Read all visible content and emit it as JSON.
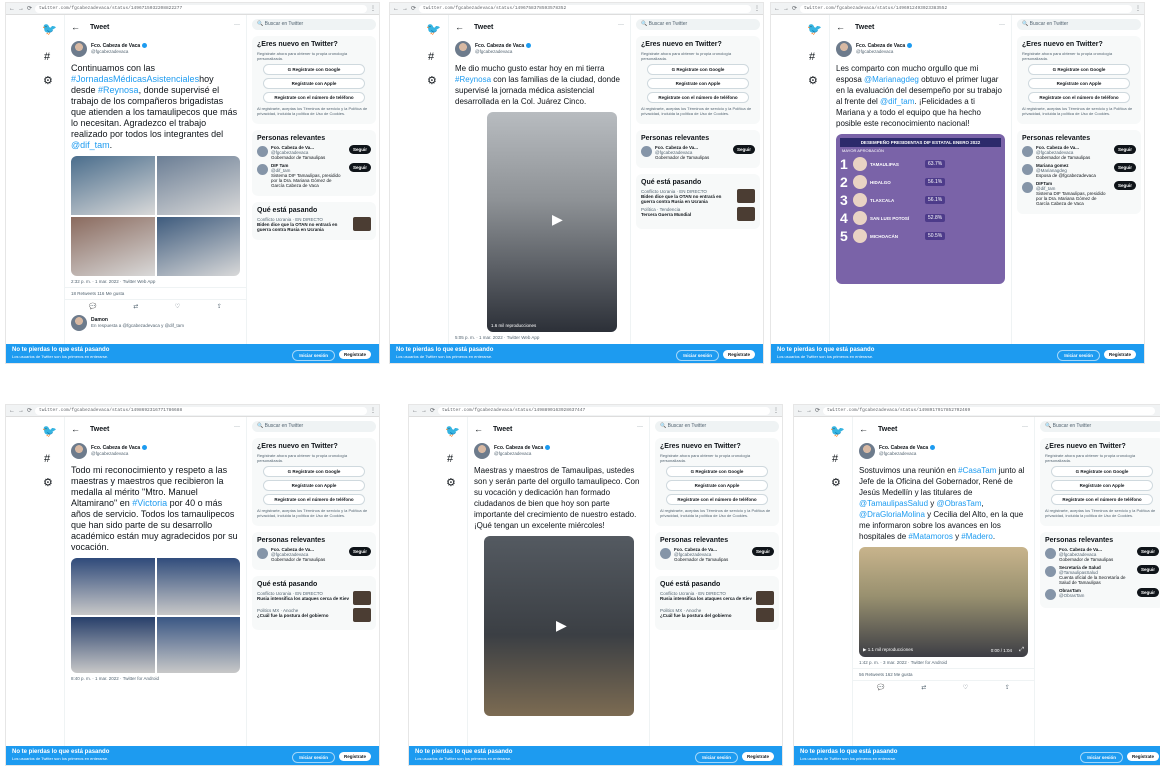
{
  "common": {
    "tweet_header": "Tweet",
    "search_placeholder": "Buscar en Twitter",
    "signup_title": "¿Eres nuevo en Twitter?",
    "signup_subtitle": "Regístrate ahora para obtener tu propia cronología personalizada.",
    "google_button": "Regístrate con Google",
    "apple_button": "Regístrate con Apple",
    "phone_button": "Regístrate con el número de teléfono",
    "terms_text": "Al registrarte, aceptas los Términos de servicio y la Política de privacidad, incluida la política de Uso de Cookies.",
    "relevant_people_title": "Personas relevantes",
    "whats_happening_title": "Qué está pasando",
    "follow_label": "Seguir",
    "banner_title": "No te pierdas lo que está pasando",
    "banner_subtitle": "Los usuarios de Twitter son los primeros en enterarse.",
    "login_label": "Iniciar sesión",
    "signup_label": "Regístrate",
    "author_name": "Fco. Cabeza de Vaca",
    "author_handle": "@fgcabezadevaca"
  },
  "panels": [
    {
      "url": "twitter.com/fgcabezadevaca/status/1496715032208822277",
      "lines": [
        {
          "text": "Continuamos con las "
        },
        {
          "text": "#JornadasMédicasAsistenciales",
          "tag": true
        },
        {
          "text": "hoy desde "
        },
        {
          "text": "#Reynosa",
          "tag": true
        },
        {
          "text": ", donde supervisé el trabajo de los compañeros brigadistas que atienden a los tamaulipecos que más lo necesitan. Agradezco el trabajo realizado por todos los integrantes del "
        },
        {
          "text": "@dif_tam",
          "tag": true
        },
        {
          "text": "."
        }
      ],
      "timestamp": "2:32 p. m. · 1 mar. 2022 · Twitter Web App",
      "stats": "18 Retweets   116 Me gusta",
      "side_people": [
        {
          "name": "Fco. Cabeza de Va...",
          "handle": "@fgcabezadevaca",
          "bio": "Gobernador de Tamaulipas"
        },
        {
          "name": "DIF Tam",
          "handle": "@dif_tam",
          "bio": "Sistema DIF Tamaulipas, presidido por la Dra. Mariana Gómez de García Cabeza de Vaca"
        }
      ],
      "side_trends": [
        {
          "meta": "Conflicto Ucrania · EN DIRECTO",
          "title": "Biden dice que la OTAN no entrará en guerra contra Rusia en Ucrania"
        }
      ],
      "reply_user": "Damon",
      "reply_text": "En respuesta a @fgcabezadevaca y @dif_tam"
    },
    {
      "url": "twitter.com/fgcabezadevaca/status/1496758378593578352",
      "lines": [
        {
          "text": "Me dio mucho gusto estar hoy en mi tierra "
        },
        {
          "text": "#Reynosa",
          "tag": true
        },
        {
          "text": " con las familias de la ciudad, donde supervisé la jornada médica asistencial desarrollada en la Col. Juárez Cinco."
        }
      ],
      "timestamp": "5:05 p. m. · 1 mar. 2022 · Twitter Web App",
      "stats": "1.6 mil reproducciones",
      "side_people": [
        {
          "name": "Fco. Cabeza de Va...",
          "handle": "@fgcabezadevaca",
          "bio": "Gobernador de Tamaulipas"
        }
      ],
      "side_trends": [
        {
          "meta": "Conflicto Ucrania · EN DIRECTO",
          "title": "Biden dice que la OTAN no entrará en guerra contra Rusia en Ucrania"
        },
        {
          "meta": "Política · Tendencia",
          "title": "Tercera Guerra Mundial"
        }
      ],
      "video_label": "1.6 mil reproducciones"
    },
    {
      "url": "twitter.com/fgcabezadevaca/status/1496912493023383552",
      "lines": [
        {
          "text": "Les comparto con mucho orgullo que mi esposa "
        },
        {
          "text": "@Marianagdeg",
          "tag": true
        },
        {
          "text": " obtuvo el primer lugar en la evaluación del desempeño por su trabajo al frente del "
        },
        {
          "text": "@dif_tam",
          "tag": true
        },
        {
          "text": ". ¡Felicidades a ti Mariana y a todo el equipo que ha hecho posible este reconocimiento nacional!"
        }
      ],
      "chart_title": "DESEMPEÑO PRESIDENTAS DIF ESTATAL",
      "chart_month": "ENERO 2022",
      "chart_subtitle": "MAYOR APROBACIÓN",
      "ranking": [
        {
          "rank": "1",
          "state": "TAMAULIPAS",
          "pct": "63.7%"
        },
        {
          "rank": "2",
          "state": "HIDALGO",
          "pct": "56.1%"
        },
        {
          "rank": "3",
          "state": "TLAXCALA",
          "pct": "56.1%"
        },
        {
          "rank": "4",
          "state": "SAN LUIS POTOSÍ",
          "pct": "52.8%"
        },
        {
          "rank": "5",
          "state": "MICHOACÁN",
          "pct": "50.5%"
        }
      ],
      "side_people": [
        {
          "name": "Fco. Cabeza de Va...",
          "handle": "@fgcabezadevaca",
          "bio": "Gobernador de Tamaulipas"
        },
        {
          "name": "Mariana gomez",
          "handle": "@Marianagdeg",
          "bio": "Esposa de @fgcabezadevaca"
        },
        {
          "name": "DIFTam",
          "handle": "@dif_tam",
          "bio": "Sistema DIF Tamaulipas, presidido por la Dra. Mariana Gómez de García Cabeza de Vaca"
        }
      ]
    },
    {
      "url": "twitter.com/fgcabezadevaca/status/1498692316771786688",
      "lines": [
        {
          "text": "Todo mi reconocimiento y respeto a las maestras y maestros que recibieron la medalla al mérito \"Mtro. Manuel Altamirano\" en "
        },
        {
          "text": "#Victoria",
          "tag": true
        },
        {
          "text": " por 40 o más años de servicio."
        },
        {
          "text": " Todos los tamaulipecos que han sido parte de su desarrollo académico están muy agradecidos por su vocación."
        }
      ],
      "timestamp": "8:40 p. m. · 1 mar. 2022 · Twitter for Android",
      "side_people": [
        {
          "name": "Fco. Cabeza de Va...",
          "handle": "@fgcabezadevaca",
          "bio": "Gobernador de Tamaulipas"
        }
      ],
      "side_trends": [
        {
          "meta": "Conflicto Ucrania · EN DIRECTO",
          "title": "Rusia intensifica los ataques cerca de Kiev"
        },
        {
          "meta": "Politics MX · Anoche",
          "title": "¿Cuál fue la postura del gobierno"
        }
      ]
    },
    {
      "url": "twitter.com/fgcabezadevaca/status/1498890163928637447",
      "lines": [
        {
          "text": "Maestras y maestros de Tamaulipas, ustedes son y serán parte del orgullo tamaulipeco. Con su vocación y dedicación han formado ciudadanos de bien que hoy son parte importante del crecimiento de nuestro estado."
        },
        {
          "text": " ¡Qué tengan un excelente miércoles!"
        }
      ],
      "side_people": [
        {
          "name": "Fco. Cabeza de Va...",
          "handle": "@fgcabezadevaca",
          "bio": "Gobernador de Tamaulipas"
        }
      ],
      "side_trends": [
        {
          "meta": "Conflicto Ucrania · EN DIRECTO",
          "title": "Rusia intensifica los ataques cerca de Kiev"
        },
        {
          "meta": "Politics MX · Anoche",
          "title": "¿Cuál fue la postura del gobierno"
        }
      ]
    },
    {
      "url": "twitter.com/fgcabezadevaca/status/1498917917852702469",
      "lines": [
        {
          "text": "Sostuvimos una reunión en "
        },
        {
          "text": "#CasaTam",
          "tag": true
        },
        {
          "text": " junto al Jefe de la Oficina del Gobernador, René de Jesús Medellín y las titulares de "
        },
        {
          "text": "@TamaulipasSalud",
          "tag": true
        },
        {
          "text": " y "
        },
        {
          "text": "@ObrasTam",
          "tag": true
        },
        {
          "text": ", "
        },
        {
          "text": "@DraGloriaMolina",
          "tag": true
        },
        {
          "text": " y Cecilia del Alto, en la que me informaron sobre los avances en los hospitales de "
        },
        {
          "text": "#Matamoros",
          "tag": true
        },
        {
          "text": " y "
        },
        {
          "text": "#Madero",
          "tag": true
        },
        {
          "text": "."
        }
      ],
      "timestamp": "1:42 p. m. · 3 mar. 2022 · Twitter for Android",
      "stats": "56 Retweets   162 Me gusta",
      "video_label": "1.1 mil reproducciones",
      "video_time": "0:00 / 1:04",
      "side_people": [
        {
          "name": "Fco. Cabeza de Va...",
          "handle": "@fgcabezadevaca",
          "bio": "Gobernador de Tamaulipas"
        },
        {
          "name": "Secretaría de Salud",
          "handle": "@TamaulipasSalud",
          "bio": "Cuenta oficial de la Secretaría de Salud de Tamaulipas"
        },
        {
          "name": "ObrasTam",
          "handle": "@ObrasTam",
          "bio": ""
        }
      ]
    }
  ]
}
